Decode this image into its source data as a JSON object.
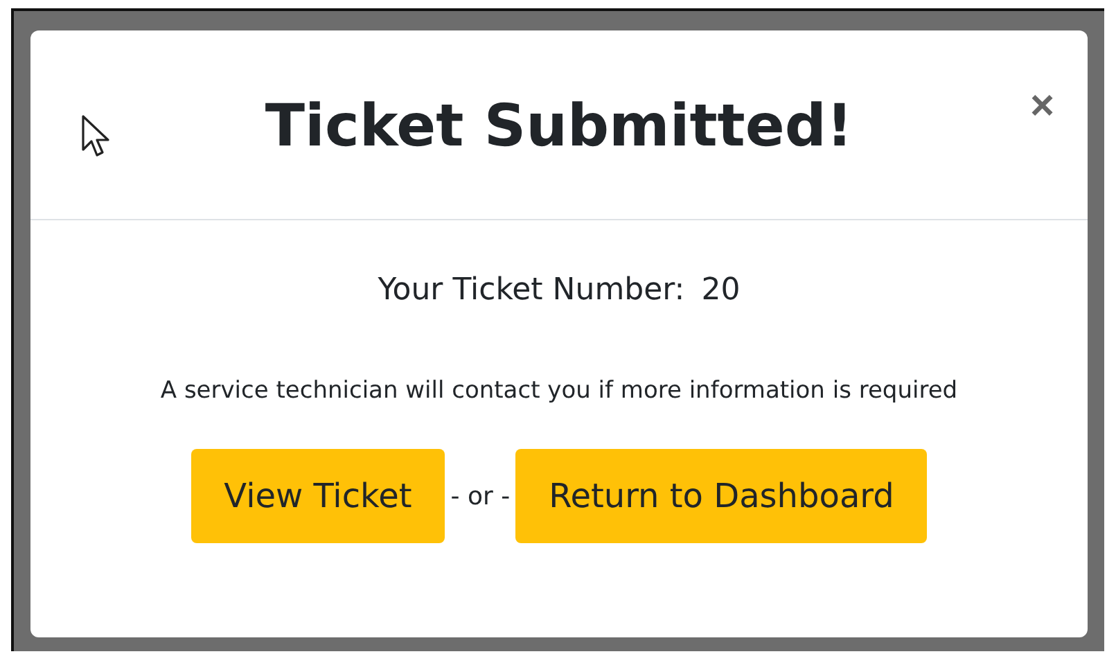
{
  "modal": {
    "title": "Ticket Submitted!",
    "close": "×",
    "ticket_label": "Your Ticket Number:",
    "ticket_number": "20",
    "message": "A service technician will contact you if more information is required",
    "buttons": [
      {
        "label": "View Ticket"
      },
      {
        "label": "Return to Dashboard"
      }
    ],
    "separator": "- or -"
  }
}
